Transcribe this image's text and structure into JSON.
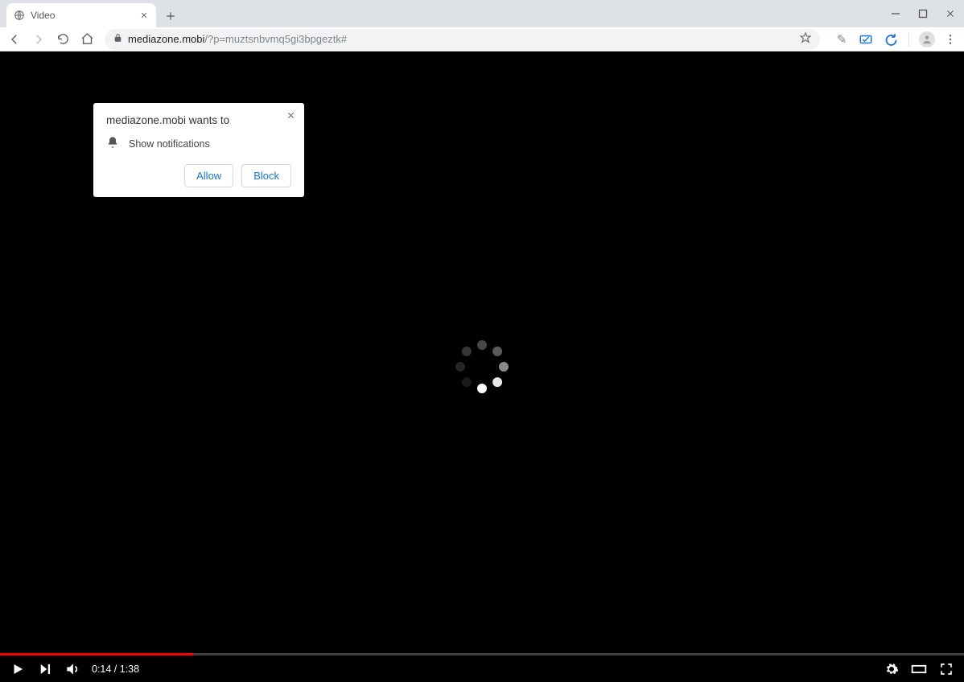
{
  "tab": {
    "title": "Video"
  },
  "address": {
    "domain": "mediazone.mobi",
    "rest": "/?p=muztsnbvmq5gi3bpgeztk#"
  },
  "permission_popup": {
    "heading": "mediazone.mobi wants to",
    "item": "Show notifications",
    "allow": "Allow",
    "block": "Block"
  },
  "video": {
    "time": "0:14 / 1:38",
    "progress_percent": 20
  }
}
